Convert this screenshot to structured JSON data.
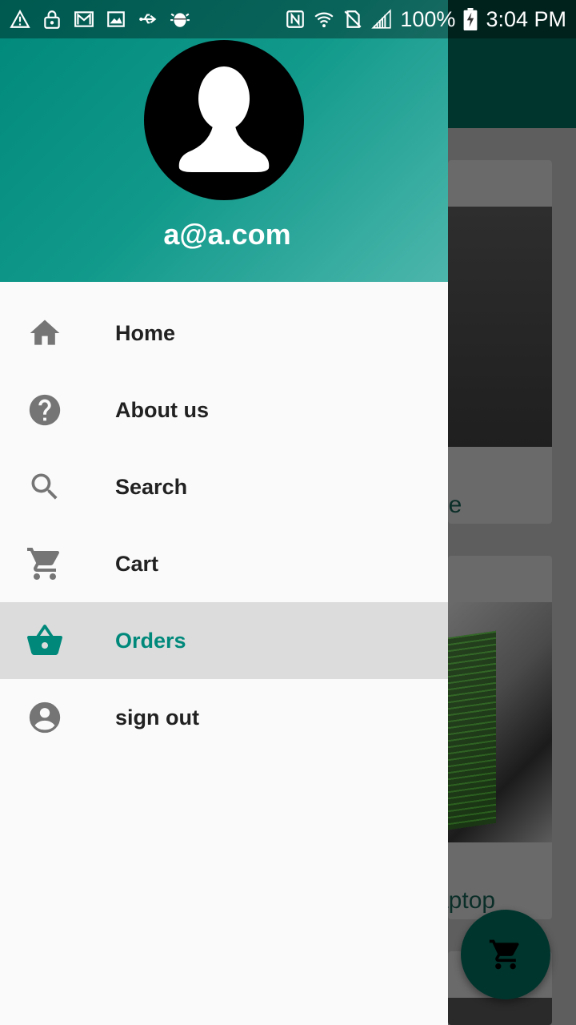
{
  "status_bar": {
    "battery": "100%",
    "time": "3:04 PM"
  },
  "drawer": {
    "email": "a@a.com",
    "items": [
      {
        "label": "Home",
        "icon": "home-icon"
      },
      {
        "label": "About us",
        "icon": "help-circle-icon"
      },
      {
        "label": "Search",
        "icon": "search-icon"
      },
      {
        "label": "Cart",
        "icon": "cart-icon"
      },
      {
        "label": "Orders",
        "icon": "basket-icon",
        "selected": true
      },
      {
        "label": "sign out",
        "icon": "account-circle-icon"
      }
    ]
  },
  "background": {
    "cards": [
      {
        "title_fragment": "ne"
      },
      {
        "title_fragment": "aptop"
      }
    ]
  },
  "colors": {
    "accent": "#00897b",
    "toolbar_dark": "#00352d",
    "icon_gray": "#757575"
  }
}
